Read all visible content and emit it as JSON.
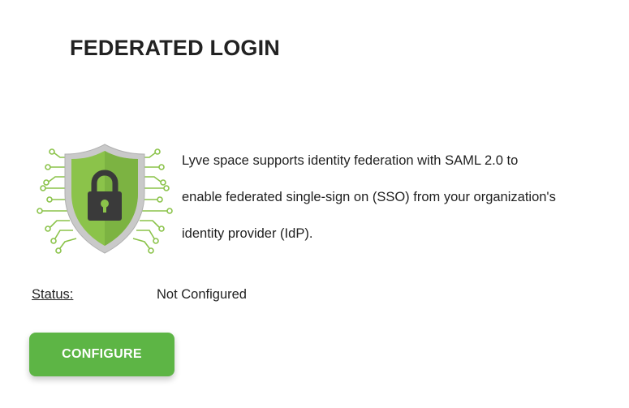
{
  "header": {
    "title": "FEDERATED LOGIN"
  },
  "hero": {
    "icon": "shield-lock-circuit-icon",
    "colors": {
      "shield_outer": "#c8c8c8",
      "shield_inner": "#8bc34a",
      "lock_body": "#3a3a3a",
      "circuit_lines": "#8bc34a"
    }
  },
  "description": {
    "line1": "Lyve space supports identity federation with SAML 2.0 to",
    "line2": "enable federated single-sign on (SSO) from your organization's",
    "line3": "identity provider (IdP)."
  },
  "status": {
    "label": "Status:",
    "value": "Not Configured"
  },
  "actions": {
    "configure_label": "CONFIGURE",
    "configure_color": "#5db545"
  }
}
